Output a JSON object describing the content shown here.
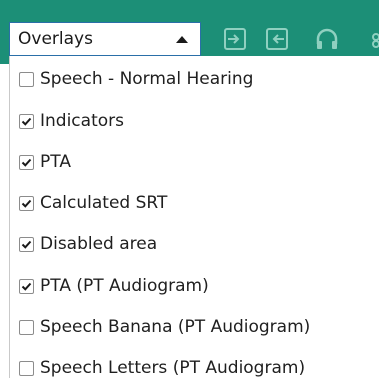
{
  "toolbar": {
    "background": "#1c8f77",
    "overlays_select": {
      "value": "Overlays",
      "icon": "caret-up-icon"
    },
    "buttons": [
      {
        "icon": "import-arrow-icon"
      },
      {
        "icon": "export-arrow-icon"
      },
      {
        "icon": "headphones-icon"
      }
    ]
  },
  "overlay_options": [
    {
      "label": "Speech - Normal Hearing",
      "checked": false
    },
    {
      "label": "Indicators",
      "checked": true
    },
    {
      "label": "PTA",
      "checked": true
    },
    {
      "label": "Calculated SRT",
      "checked": true
    },
    {
      "label": "Disabled area",
      "checked": true
    },
    {
      "label": "PTA (PT Audiogram)",
      "checked": true
    },
    {
      "label": "Speech Banana (PT Audiogram)",
      "checked": false
    },
    {
      "label": "Speech Letters (PT Audiogram)",
      "checked": false
    }
  ]
}
